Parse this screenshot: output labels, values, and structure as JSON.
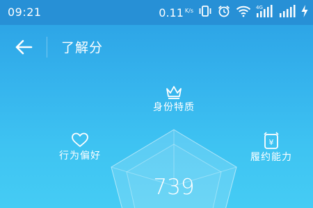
{
  "status_bar": {
    "time": "09:21",
    "net_speed": "0.11",
    "net_speed_unit": "K/s",
    "icons": [
      "vibrate-icon",
      "alarm-icon",
      "wifi-icon",
      "signal-4g-icon",
      "signal-icon",
      "charging-icon"
    ],
    "network_label": "4G"
  },
  "header": {
    "title": "了解分",
    "back_icon": "back-arrow-icon"
  },
  "radar": {
    "dimensions": [
      {
        "label": "身份特质",
        "icon": "crown-icon"
      },
      {
        "label": "行为偏好",
        "icon": "heart-icon"
      },
      {
        "label": "履约能力",
        "icon": "wallet-icon"
      }
    ],
    "currency_symbol": "¥",
    "score": "739"
  },
  "colors": {
    "status_bar": "#2790d6",
    "background_top": "#2a9fe3",
    "background_bottom": "#45ccf4",
    "text": "#ffffff"
  }
}
